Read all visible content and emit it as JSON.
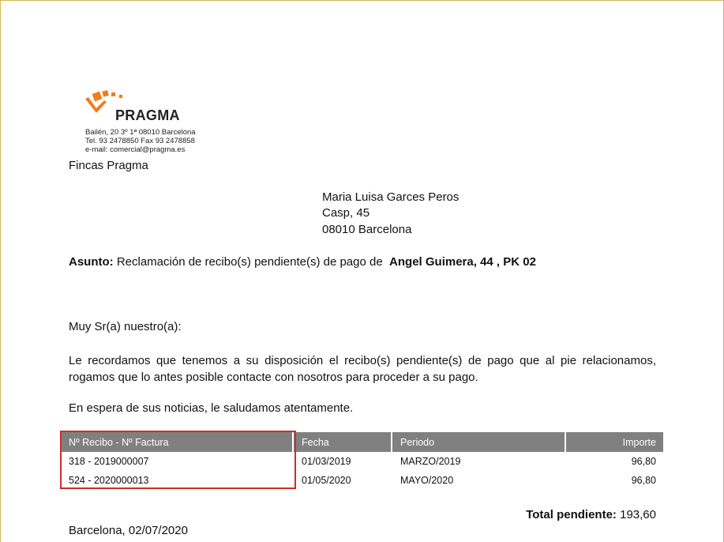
{
  "colors": {
    "highlight": "#d42a2a",
    "table_header_bg": "#808080",
    "logo_orange": "#f07d1e",
    "page_border": "#d4b65a"
  },
  "company": {
    "logo_name": "PRAGMA",
    "address": "Bailén, 20 3º 1ª 08010 Barcelona",
    "phone": "Tel. 93 2478850 Fax 93 2478858",
    "email": "e-mail: comercial@pragma.es",
    "sender": "Fincas Pragma"
  },
  "recipient": {
    "name": "Maria Luisa Garces Peros",
    "street": "Casp, 45",
    "city": "08010 Barcelona"
  },
  "subject": {
    "label": "Asunto:",
    "text": "Reclamación de recibo(s) pendiente(s) de pago de",
    "property": "Angel Guimera, 44 , PK 02"
  },
  "body": {
    "greeting": "Muy Sr(a) nuestro(a):",
    "paragraph": "Le recordamos que tenemos a su disposición el recibo(s) pendiente(s) de pago que al pie relacionamos, rogamos que lo antes posible contacte con nosotros para proceder a su pago.",
    "closing": "En espera de sus noticias, le saludamos atentamente."
  },
  "table": {
    "headers": [
      "Nº Recibo - Nº Factura",
      "Fecha",
      "Periodo",
      "Importe"
    ],
    "rows": [
      [
        "318 - 2019000007",
        "01/03/2019",
        "MARZO/2019",
        "96,80"
      ],
      [
        "524 - 2020000013",
        "01/05/2020",
        "MAYO/2020",
        "96,80"
      ]
    ]
  },
  "total": {
    "label": "Total pendiente:",
    "value": "193,60"
  },
  "footer": {
    "place_date": "Barcelona, 02/07/2020"
  }
}
